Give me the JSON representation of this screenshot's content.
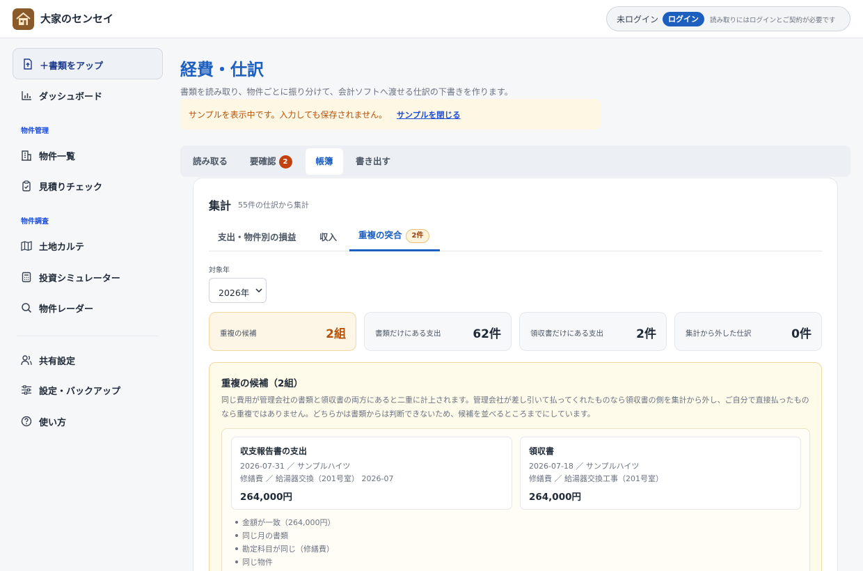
{
  "app": {
    "title": "大家のセンセイ"
  },
  "auth": {
    "status": "未ログイン",
    "login_label": "ログイン",
    "note": "読み取りにはログインとご契約が必要です"
  },
  "sidebar": {
    "upload_label": "＋書類をアップ",
    "dashboard_label": "ダッシュボード",
    "section_property": "物件管理",
    "property_list": "物件一覧",
    "estimate_check": "見積りチェック",
    "section_research": "物件調査",
    "land_karte": "土地カルテ",
    "simulator": "投資シミュレーター",
    "radar": "物件レーダー",
    "sharing": "共有設定",
    "settings": "設定・バックアップ",
    "help": "使い方"
  },
  "page": {
    "title": "経費・仕訳",
    "subtitle": "書類を読み取り、物件ごとに振り分けて、会計ソフトへ渡せる仕訳の下書きを作ります。",
    "banner_text": "サンプルを表示中です。入力しても保存されません。",
    "banner_link": "サンプルを閉じる"
  },
  "tabs": {
    "read": "読み取る",
    "review": "要確認",
    "review_count": "2",
    "ledger": "帳簿",
    "export": "書き出す"
  },
  "summary": {
    "title": "集計",
    "subtitle": "55件の仕訳から集計",
    "subtabs": {
      "expense": "支出・物件別の損益",
      "income": "収入",
      "duplicate": "重複の突合",
      "duplicate_badge": "2件"
    },
    "year_label": "対象年",
    "year_value": "2026年",
    "stats": [
      {
        "label": "重複の候補",
        "value": "2組"
      },
      {
        "label": "書類だけにある支出",
        "value": "62件"
      },
      {
        "label": "領収書だけにある支出",
        "value": "2件"
      },
      {
        "label": "集計から外した仕訳",
        "value": "0件"
      }
    ]
  },
  "duplicates": {
    "title": "重複の候補（2組）",
    "description": "同じ費用が管理会社の書類と領収書の両方にあると二重に計上されます。管理会社が差し引いて払ってくれたものなら領収書の側を集計から外し、ご自分で直接払ったものなら重複ではありません。どちらかは書類からは判断できないため、候補を並べるところまでにしています。",
    "left": {
      "title": "収支報告書の支出",
      "line1": "2026-07-31 ／ サンプルハイツ",
      "line2": "修繕費 ／ 給湯器交換（201号室） 2026-07",
      "amount": "264,000円"
    },
    "right": {
      "title": "領収書",
      "line1": "2026-07-18 ／ サンプルハイツ",
      "line2": "修繕費 ／ 給湯器交換工事（201号室）",
      "amount": "264,000円"
    },
    "reasons": [
      "金額が一致（264,000円）",
      "同じ月の書類",
      "勘定科目が同じ（修繕費）",
      "同じ物件"
    ]
  }
}
